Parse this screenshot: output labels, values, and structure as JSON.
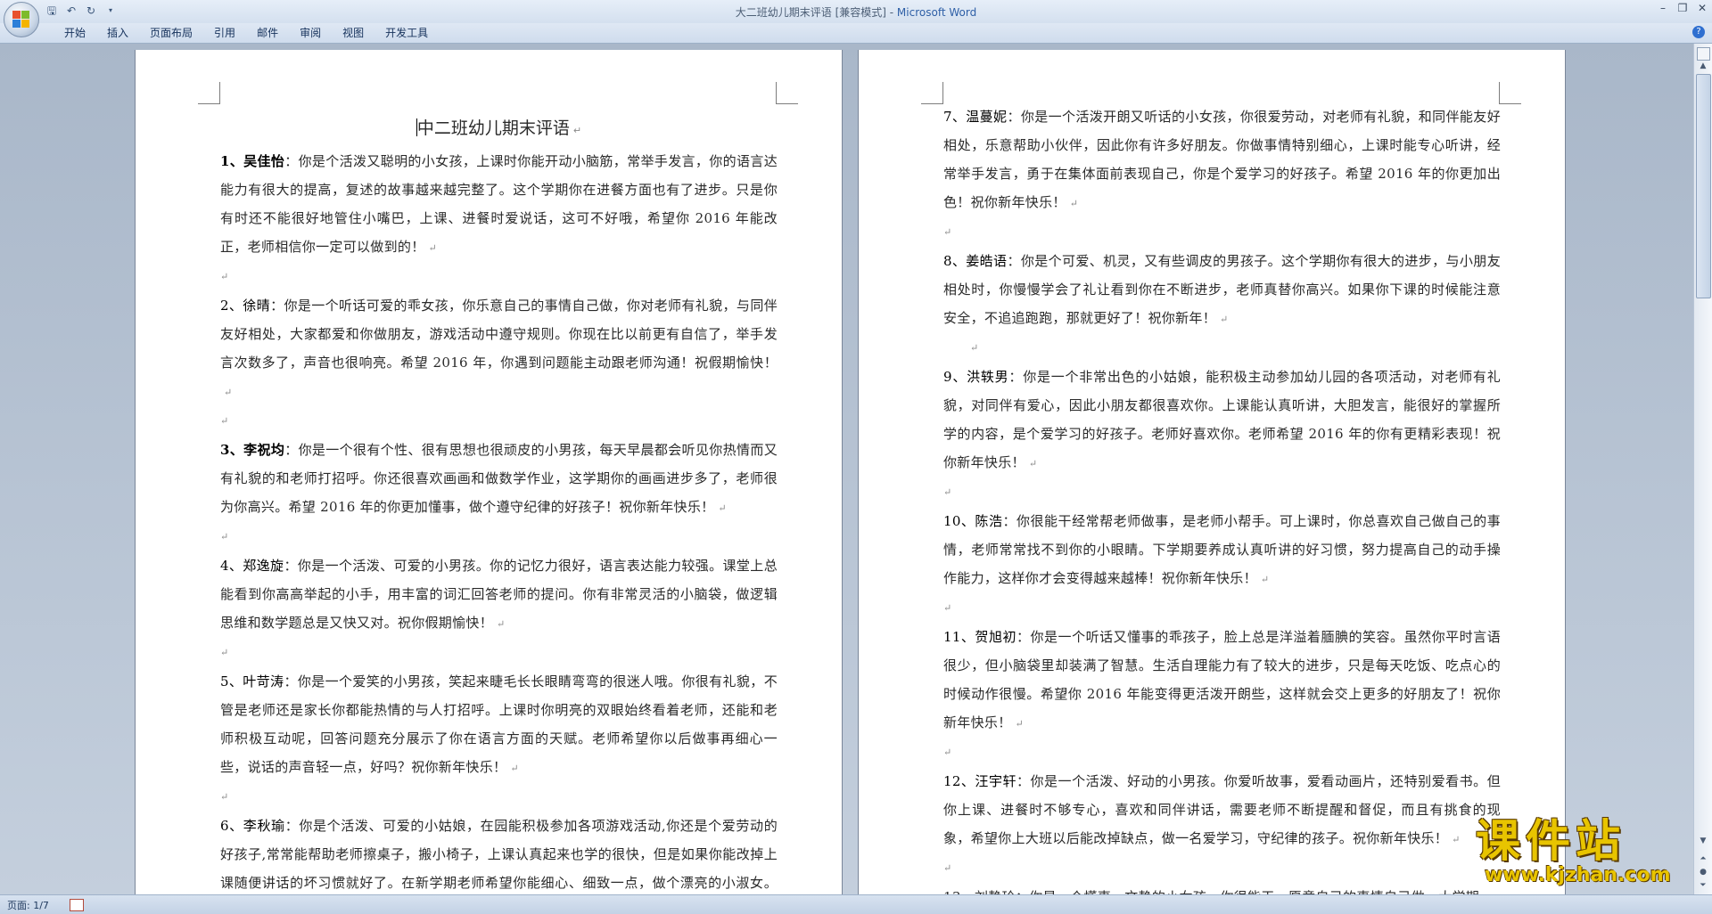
{
  "window": {
    "title_doc": "大二班幼儿期末评语 [兼容模式] - ",
    "title_app": "Microsoft Word"
  },
  "ribbon": {
    "tabs": [
      "开始",
      "插入",
      "页面布局",
      "引用",
      "邮件",
      "审阅",
      "视图",
      "开发工具"
    ]
  },
  "document": {
    "title": "中二班幼儿期末评语",
    "left_paragraphs": [
      {
        "name": "1、吴佳怡",
        "bold_name": true,
        "text": "：你是个活泼又聪明的小女孩，上课时你能开动小脑筋，常举手发言，你的语言达能力有很大的提高，复述的故事越来越完整了。这个学期你在进餐方面也有了进步。只是你有时还不能很好地管住小嘴巴，上课、进餐时爱说话，这可不好哦，希望你 2016 年能改正，老师相信你一定可以做到的！"
      },
      {
        "name": "2、徐晴",
        "bold_name": false,
        "text": "：你是一个听话可爱的乖女孩，你乐意自己的事情自己做，你对老师有礼貌，与同伴友好相处，大家都爱和你做朋友，游戏活动中遵守规则。你现在比以前更有自信了，举手发言次数多了，声音也很响亮。希望 2016 年，你遇到问题能主动跟老师沟通！祝假期愉快！"
      },
      {
        "name": "3、李祝均",
        "bold_name": true,
        "text": "：你是一个很有个性、很有思想也很顽皮的小男孩，每天早晨都会听见你热情而又有礼貌的和老师打招呼。你还很喜欢画画和做数学作业，这学期你的画画进步多了，老师很为你高兴。希望 2016 年的你更加懂事，做个遵守纪律的好孩子！祝你新年快乐！"
      },
      {
        "name": "4、郑逸旋",
        "bold_name": false,
        "text": "：你是一个活泼、可爱的小男孩。你的记忆力很好，语言表达能力较强。课堂上总能看到你高高举起的小手，用丰富的词汇回答老师的提问。你有非常灵活的小脑袋，做逻辑思维和数学题总是又快又对。祝你假期愉快！"
      },
      {
        "name": "5、叶苛涛",
        "bold_name": false,
        "text": "：你是一个爱笑的小男孩，笑起来睫毛长长眼睛弯弯的很迷人哦。你很有礼貌，不管是老师还是家长你都能热情的与人打招呼。上课时你明亮的双眼始终看着老师，还能和老师积极互动呢，回答问题充分展示了你在语言方面的天赋。老师希望你以后做事再细心一些，说话的声音轻一点，好吗？祝你新年快乐！"
      },
      {
        "name": "6、李秋瑜",
        "bold_name": false,
        "text": "：你是个活泼、可爱的小姑娘，在园能积极参加各项游戏活动,你还是个爱劳动的好孩子,常常能帮助老师擦桌子，搬小椅子，上课认真起来也学的很快，但是如果你能改掉上课随便讲话的坏习惯就好了。在新学期老师希望你能细心、细致一点，做个漂亮的小淑女。"
      }
    ],
    "right_paragraphs": [
      {
        "name": "7、温蔓妮",
        "text": "：你是一个活泼开朗又听话的小女孩，你很爱劳动，对老师有礼貌，和同伴能友好相处，乐意帮助小伙伴，因此你有许多好朋友。你做事情特别细心，上课时能专心听讲，经常举手发言，勇于在集体面前表现自己，你是个爱学习的好孩子。希望 2016 年的你更加出色！祝你新年快乐！",
        "after_indent": false
      },
      {
        "name": "8、姜皓语",
        "text": "：你是个可爱、机灵，又有些调皮的男孩子。这个学期你有很大的进步，与小朋友相处时，你慢慢学会了礼让看到你在不断进步，老师真替你高兴。如果你下课的时候能注意安全，不追追跑跑，那就更好了！祝你新年！",
        "after_indent": true
      },
      {
        "name": "9、洪轶男",
        "text": "：你是一个非常出色的小姑娘，能积极主动参加幼儿园的各项活动，对老师有礼貌，对同伴有爱心，因此小朋友都很喜欢你。上课能认真听讲，大胆发言，能很好的掌握所学的内容，是个爱学习的好孩子。老师好喜欢你。老师希望 2016 年的你有更精彩表现！祝你新年快乐！",
        "after_indent": false
      },
      {
        "name": "10、陈浩",
        "text": "：你很能干经常帮老师做事，是老师小帮手。可上课时，你总喜欢自己做自己的事情，老师常常找不到你的小眼睛。下学期要养成认真听讲的好习惯，努力提高自己的动手操作能力，这样你才会变得越来越棒！祝你新年快乐！",
        "after_indent": false
      },
      {
        "name": "11、贺旭初",
        "text": "：你是一个听话又懂事的乖孩子，脸上总是洋溢着腼腆的笑容。虽然你平时言语很少，但小脑袋里却装满了智慧。生活自理能力有了较大的进步，只是每天吃饭、吃点心的时候动作很慢。希望你 2016 年能变得更活泼开朗些，这样就会交上更多的好朋友了！祝你新年快乐！",
        "after_indent": false
      },
      {
        "name": "12、汪宇轩",
        "text": "：你是一个活泼、好动的小男孩。你爱听故事，爱看动画片，还特别爱看书。但你上课、进餐时不够专心，喜欢和同伴讲话，需要老师不断提醒和督促，而且有挑食的现象，希望你上大班以后能改掉缺点，做一名爱学习，守纪律的孩子。祝你新年快乐！",
        "after_indent": false
      }
    ],
    "right_last_partial": "13、刘静玲：你是一个懂事、文静的小女孩，你很能干，愿意自己的事情自己做，大学期"
  },
  "statusbar": {
    "page": "页面: 1/7"
  },
  "watermark": {
    "cn": "课件站",
    "url": "www.kjzhan.com"
  },
  "colors": {
    "accent": "#2e5fa6",
    "watermark": "#e8c400"
  }
}
